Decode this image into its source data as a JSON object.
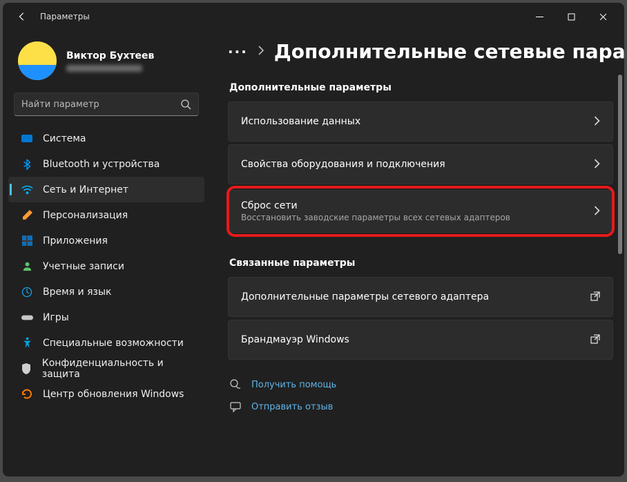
{
  "window": {
    "title": "Параметры"
  },
  "profile": {
    "name": "Виктор Бухтеев"
  },
  "search": {
    "placeholder": "Найти параметр"
  },
  "sidebar": {
    "items": [
      {
        "label": "Система"
      },
      {
        "label": "Bluetooth и устройства"
      },
      {
        "label": "Сеть и Интернет"
      },
      {
        "label": "Персонализация"
      },
      {
        "label": "Приложения"
      },
      {
        "label": "Учетные записи"
      },
      {
        "label": "Время и язык"
      },
      {
        "label": "Игры"
      },
      {
        "label": "Специальные возможности"
      },
      {
        "label": "Конфиденциальность и защита"
      },
      {
        "label": "Центр обновления Windows"
      }
    ],
    "active": 2
  },
  "breadcrumb": {
    "ellipsis": "···",
    "heading": "Дополнительные сетевые параметр"
  },
  "section1": {
    "label": "Дополнительные параметры",
    "data_usage": "Использование данных",
    "hw_props": "Свойства оборудования и подключения",
    "net_reset_title": "Сброс сети",
    "net_reset_sub": "Восстановить заводские параметры всех сетевых адаптеров"
  },
  "section2": {
    "label": "Связанные параметры",
    "adapter_opts": "Дополнительные параметры сетевого адаптера",
    "firewall": "Брандмауэр Windows"
  },
  "footer": {
    "help": "Получить помощь",
    "feedback": "Отправить отзыв"
  }
}
